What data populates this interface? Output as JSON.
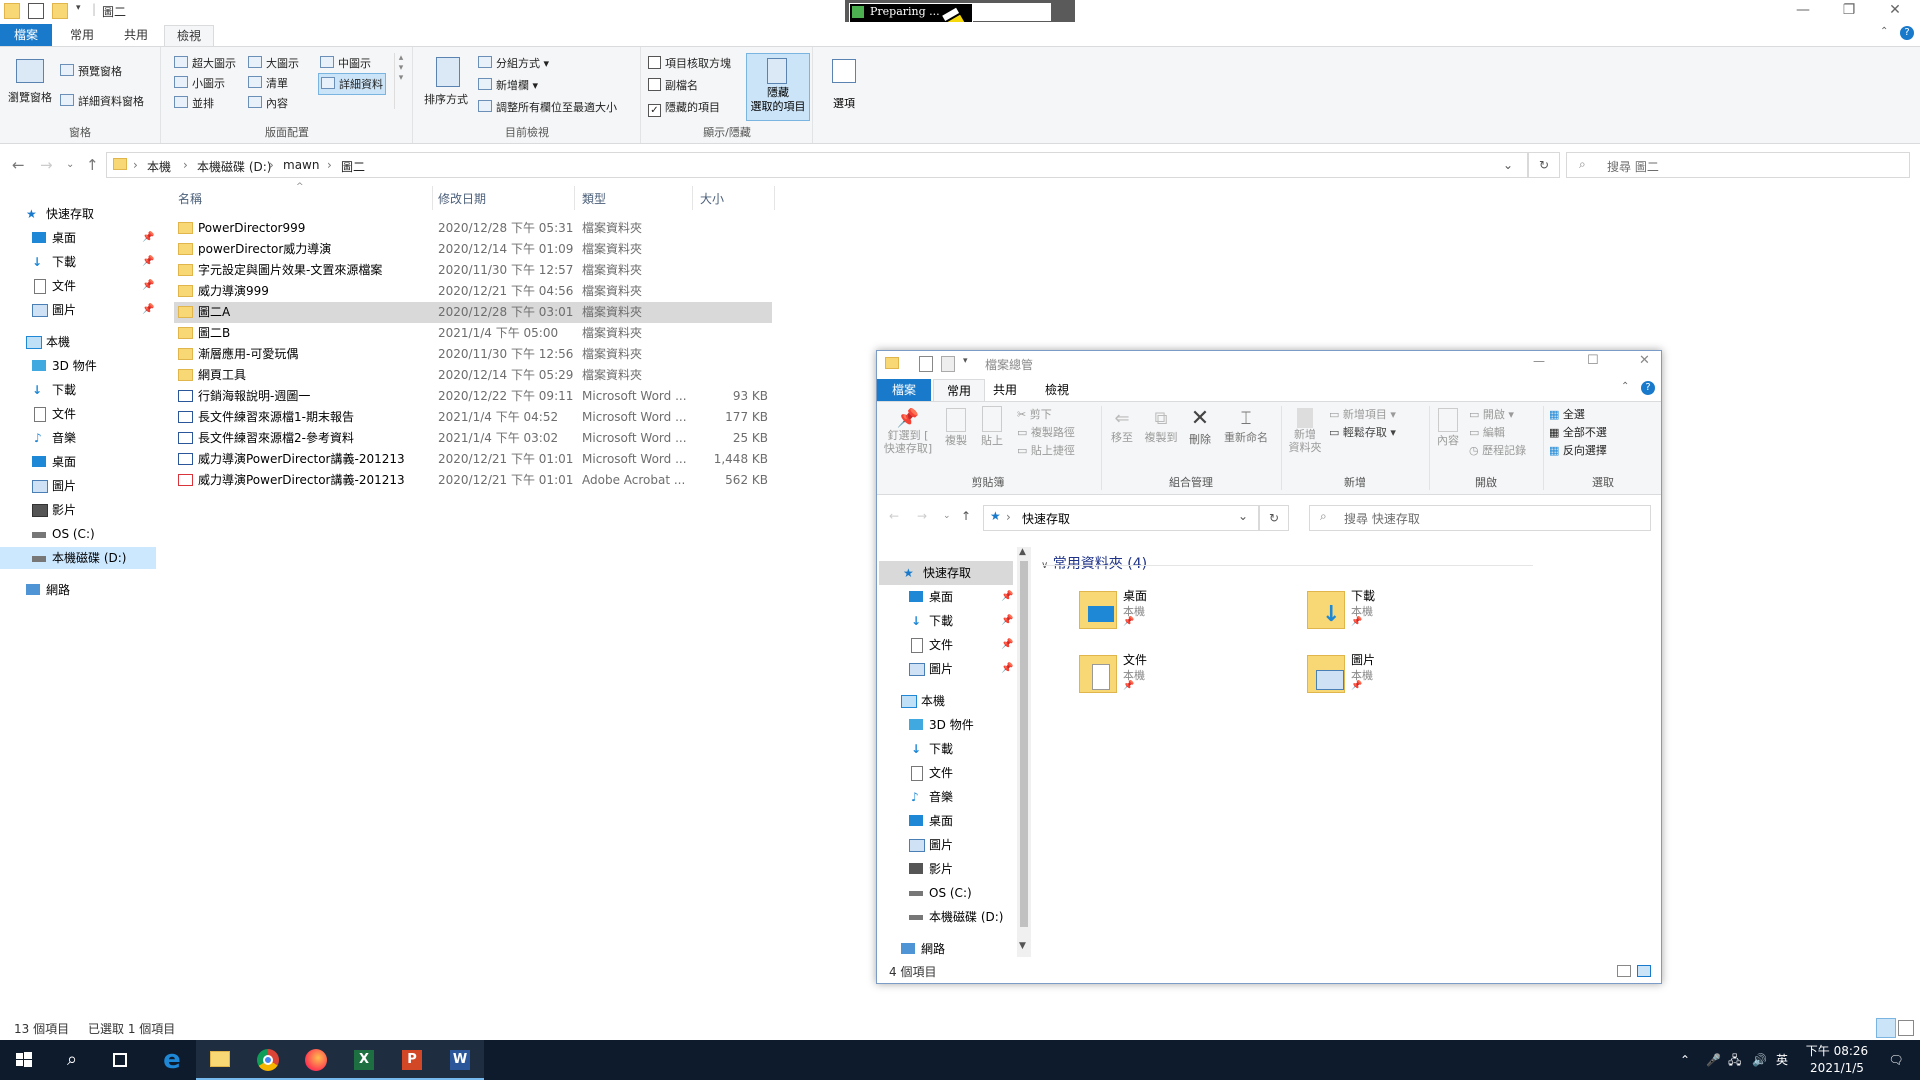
{
  "main": {
    "title": "圖二",
    "tabs": [
      "檔案",
      "常用",
      "共用",
      "檢視"
    ],
    "ribbon": {
      "panes": {
        "navigation_pane": "瀏覽窗格",
        "preview_pane": "預覽窗格",
        "details_pane": "詳細資料窗格",
        "label": "窗格"
      },
      "layout": {
        "xl_icons": "超大圖示",
        "large_icons": "大圖示",
        "medium_icons": "中圖示",
        "small_icons": "小圖示",
        "list": "清單",
        "details": "詳細資料",
        "tiles": "並排",
        "content": "內容",
        "label": "版面配置"
      },
      "current_view": {
        "sort_by": "排序方式",
        "group_by": "分組方式",
        "add_columns": "新增欄",
        "size_all_columns": "調整所有欄位至最適大小",
        "label": "目前檢視"
      },
      "show_hide": {
        "item_checkboxes": "項目核取方塊",
        "file_name_extensions": "副檔名",
        "hidden_items": "隱藏的項目",
        "hide_selected": "隱藏\n選取的項目",
        "label": "顯示/隱藏",
        "options": "選項"
      }
    },
    "address": {
      "crumbs": [
        "本機",
        "本機磁碟 (D:)",
        "mawn",
        "圖二"
      ],
      "search_placeholder": "搜尋 圖二"
    },
    "nav": {
      "quick_access": "快速存取",
      "qa_items": [
        "桌面",
        "下載",
        "文件",
        "圖片"
      ],
      "this_pc": "本機",
      "pc_items": [
        "3D 物件",
        "下載",
        "文件",
        "音樂",
        "桌面",
        "圖片",
        "影片",
        "OS (C:)",
        "本機磁碟 (D:)"
      ],
      "network": "網路"
    },
    "columns": {
      "name": "名稱",
      "date": "修改日期",
      "type": "類型",
      "size": "大小"
    },
    "files": [
      {
        "name": "PowerDirector999",
        "date": "2020/12/28 下午 05:31",
        "type": "檔案資料夾",
        "size": "",
        "icon": "folder"
      },
      {
        "name": "powerDirector威力導演",
        "date": "2020/12/14 下午 01:09",
        "type": "檔案資料夾",
        "size": "",
        "icon": "folder"
      },
      {
        "name": "字元設定與圖片效果-文置來源檔案",
        "date": "2020/11/30 下午 12:57",
        "type": "檔案資料夾",
        "size": "",
        "icon": "folder"
      },
      {
        "name": "威力導演999",
        "date": "2020/12/21 下午 04:56",
        "type": "檔案資料夾",
        "size": "",
        "icon": "folder"
      },
      {
        "name": "圖二A",
        "date": "2020/12/28 下午 03:01",
        "type": "檔案資料夾",
        "size": "",
        "icon": "folder",
        "selected": true
      },
      {
        "name": "圖二B",
        "date": "2021/1/4 下午 05:00",
        "type": "檔案資料夾",
        "size": "",
        "icon": "folder"
      },
      {
        "name": "漸層應用-可愛玩偶",
        "date": "2020/11/30 下午 12:56",
        "type": "檔案資料夾",
        "size": "",
        "icon": "folder"
      },
      {
        "name": "網頁工具",
        "date": "2020/12/14 下午 05:29",
        "type": "檔案資料夾",
        "size": "",
        "icon": "folder"
      },
      {
        "name": "行銷海報說明-週圖一",
        "date": "2020/12/22 下午 09:11",
        "type": "Microsoft Word ...",
        "size": "93 KB",
        "icon": "word"
      },
      {
        "name": "長文件練習來源檔1-期末報告",
        "date": "2021/1/4 下午 04:52",
        "type": "Microsoft Word ...",
        "size": "177 KB",
        "icon": "word"
      },
      {
        "name": "長文件練習來源檔2-參考資料",
        "date": "2021/1/4 下午 03:02",
        "type": "Microsoft Word ...",
        "size": "25 KB",
        "icon": "word"
      },
      {
        "name": "威力導演PowerDirector講義-201213",
        "date": "2020/12/21 下午 01:01",
        "type": "Microsoft Word ...",
        "size": "1,448 KB",
        "icon": "word"
      },
      {
        "name": "威力導演PowerDirector講義-201213",
        "date": "2020/12/21 下午 01:01",
        "type": "Adobe Acrobat ...",
        "size": "562 KB",
        "icon": "pdf"
      }
    ],
    "status": {
      "count": "13 個項目",
      "selected": "已選取 1 個項目"
    }
  },
  "preparing": "Preparing ...",
  "win2": {
    "title": "檔案總管",
    "tabs": [
      "檔案",
      "常用",
      "共用",
      "檢視"
    ],
    "ribbon": {
      "pin": "釘選到 [\n快速存取]",
      "copy": "複製",
      "paste": "貼上",
      "cut": "剪下",
      "copy_path": "複製路徑",
      "paste_shortcut": "貼上捷徑",
      "clipboard": "剪貼簿",
      "move_to": "移至",
      "copy_to": "複製到",
      "delete": "刪除",
      "rename": "重新命名",
      "organize": "組合管理",
      "new_folder": "新增\n資料夾",
      "new_item": "新增項目",
      "easy_access": "輕鬆存取",
      "new": "新增",
      "properties": "內容",
      "open": "開啟",
      "edit": "編輯",
      "history": "歷程記錄",
      "open_group": "開啟",
      "select_all": "全選",
      "select_none": "全部不選",
      "invert": "反向選擇",
      "select": "選取"
    },
    "address": "快速存取",
    "search_placeholder": "搜尋 快速存取",
    "nav": {
      "quick_access": "快速存取",
      "qa_items": [
        "桌面",
        "下載",
        "文件",
        "圖片"
      ],
      "this_pc": "本機",
      "pc_items": [
        "3D 物件",
        "下載",
        "文件",
        "音樂",
        "桌面",
        "圖片",
        "影片",
        "OS (C:)",
        "本機磁碟 (D:)"
      ],
      "network": "網路"
    },
    "group_header": "常用資料夾 (4)",
    "folders": [
      {
        "name": "桌面",
        "sub": "本機"
      },
      {
        "name": "下載",
        "sub": "本機"
      },
      {
        "name": "文件",
        "sub": "本機"
      },
      {
        "name": "圖片",
        "sub": "本機"
      }
    ],
    "status": "4 個項目"
  },
  "taskbar": {
    "ime": "英",
    "time": "下午 08:26",
    "date": "2021/1/5"
  }
}
